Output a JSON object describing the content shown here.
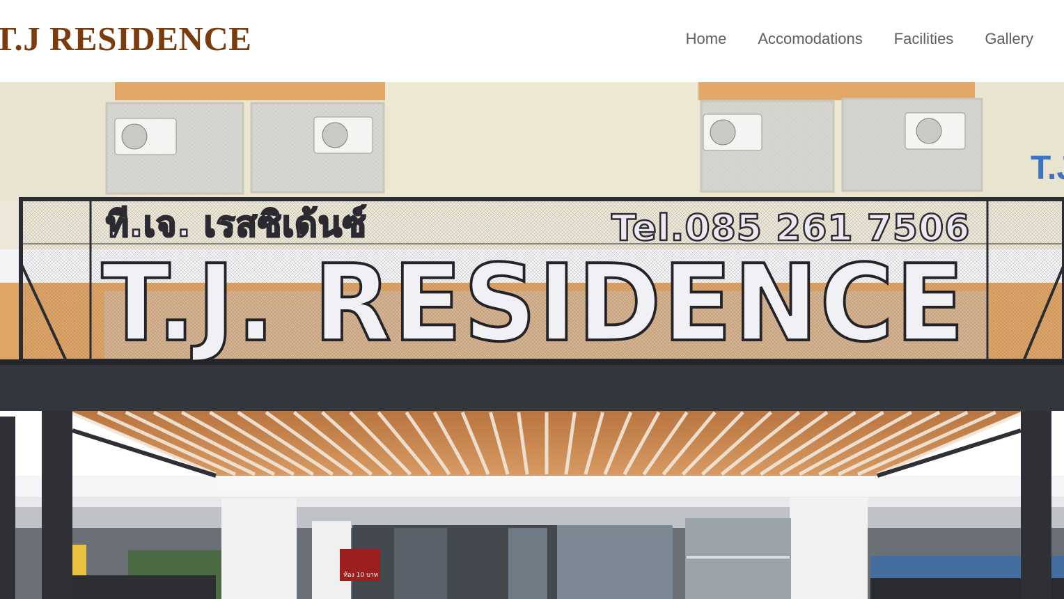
{
  "header": {
    "logo_text": "T.J RESIDENCE",
    "nav": [
      {
        "label": "Home"
      },
      {
        "label": "Accomodations"
      },
      {
        "label": "Facilities"
      },
      {
        "label": "Gallery"
      }
    ]
  },
  "hero": {
    "sign_thai": "ที.เจ. เรสซิเด้นซ์",
    "sign_tel": "Tel.085 261 7506",
    "sign_main": "T.J. RESIDENCE",
    "side_sign": "T.J",
    "door_sign": "ห้อง 10 บาท"
  },
  "colors": {
    "logo": "#7a3b0e",
    "nav_text": "#5e5e5e",
    "wall_cream": "#ece6cf",
    "wall_orange": "#e3a768",
    "sign_frame": "#2b2c33",
    "wood": "#c8804a"
  }
}
